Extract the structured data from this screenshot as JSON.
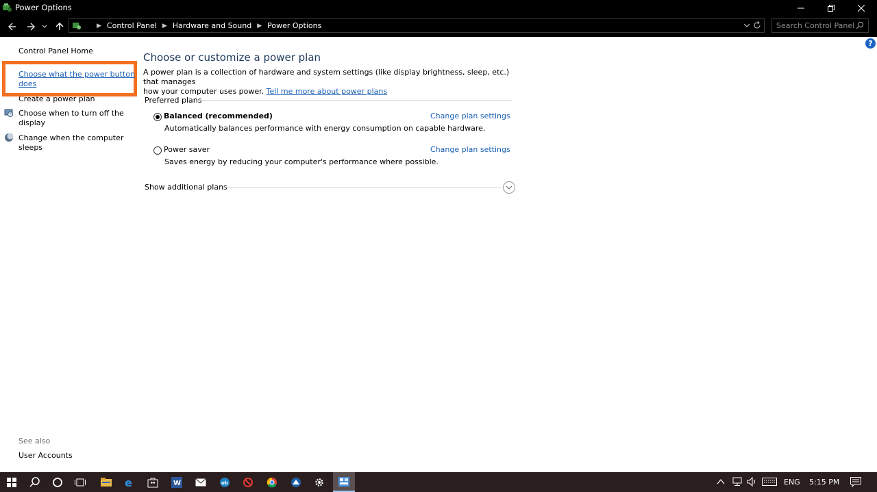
{
  "window": {
    "title": "Power Options",
    "controls": {
      "minimize": "minimize-icon",
      "restore": "restore-icon",
      "close": "close-icon"
    }
  },
  "address_bar": {
    "breadcrumbs": [
      "Control Panel",
      "Hardware and Sound",
      "Power Options"
    ],
    "search_placeholder": "Search Control Panel"
  },
  "left_nav": {
    "home": "Control Panel Home",
    "items": [
      {
        "label": "Choose what the power button does",
        "line1": "Choose what the power button",
        "line2": "does"
      },
      {
        "label": "Create a power plan"
      },
      {
        "line1": "Choose when to turn off the",
        "line2": "display",
        "icon": "display-icon"
      },
      {
        "line1": "Change when the computer",
        "line2": "sleeps",
        "icon": "moon-icon"
      }
    ],
    "see_also": "See also",
    "see_also_items": [
      "User Accounts"
    ]
  },
  "main": {
    "heading": "Choose or customize a power plan",
    "description_line1": "A power plan is a collection of hardware and system settings (like display brightness, sleep, etc.) that manages",
    "description_line2": "how your computer uses power.",
    "learn_more": "Tell me more about power plans",
    "group_label": "Preferred plans",
    "plans": [
      {
        "name": "Balanced (recommended)",
        "selected": true,
        "description": "Automatically balances performance with energy consumption on capable hardware.",
        "link": "Change plan settings"
      },
      {
        "name": "Power saver",
        "selected": false,
        "description": "Saves energy by reducing your computer's performance where possible.",
        "link": "Change plan settings"
      }
    ],
    "additional": "Show additional plans"
  },
  "taskbar": {
    "language": "ENG",
    "time": "5:15 PM",
    "apps": [
      "start-icon",
      "search-icon",
      "cortana-icon",
      "task-view-icon",
      "file-explorer-icon",
      "edge-icon",
      "store-icon",
      "word-icon",
      "mail-icon",
      "app-icon",
      "block-icon",
      "chrome-icon",
      "app-icon-2",
      "settings-icon",
      "control-panel-icon"
    ]
  },
  "colors": {
    "accent_link": "#1a5fb4",
    "heading": "#1e395b",
    "highlight": "#f37021"
  }
}
